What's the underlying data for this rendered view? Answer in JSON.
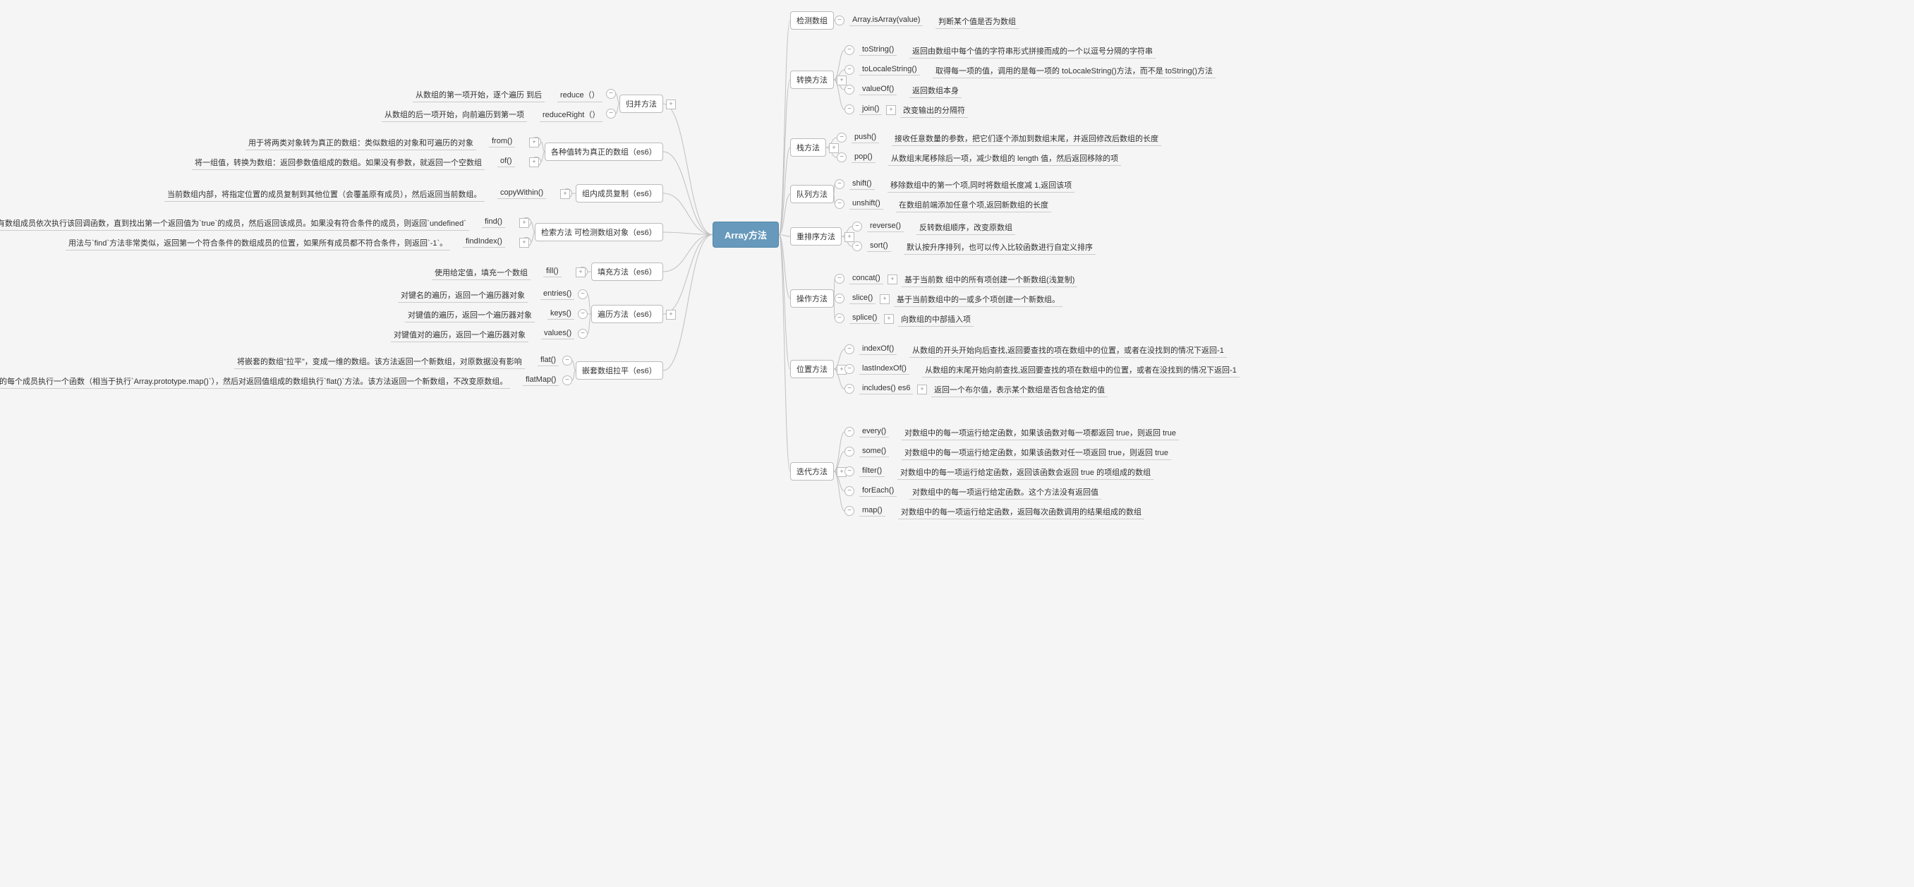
{
  "root": {
    "label": "Array方法"
  },
  "right": [
    {
      "label": "检测数组",
      "expand": false,
      "children": [
        {
          "label": "Array.isArray(value)",
          "note": "判断某个值是否为数组",
          "expand": false
        }
      ]
    },
    {
      "label": "转换方法",
      "expand": true,
      "children": [
        {
          "label": "toString()",
          "note": "返回由数组中每个值的字符串形式拼接而成的一个以逗号分隔的字符串",
          "expand": false
        },
        {
          "label": "toLocaleString()",
          "note": "取得每一项的值，调用的是每一项的 toLocaleString()方法，而不是 toString()方法",
          "expand": false
        },
        {
          "label": "valueOf()",
          "note": "返回数组本身",
          "expand": false
        },
        {
          "label": "join()",
          "note": "改变输出的分隔符",
          "expand": true
        }
      ]
    },
    {
      "label": "栈方法",
      "expand": true,
      "children": [
        {
          "label": "push()",
          "note": "接收任意数量的参数，把它们逐个添加到数组末尾，并返回修改后数组的长度",
          "expand": false
        },
        {
          "label": "pop()",
          "note": "从数组末尾移除后一项，减少数组的 length 值，然后返回移除的项",
          "expand": false
        }
      ]
    },
    {
      "label": "队列方法",
      "expand": false,
      "children": [
        {
          "label": "shift()",
          "note": "移除数组中的第一个项,同时将数组长度减 1,返回该项",
          "expand": false
        },
        {
          "label": "unshift()",
          "note": "在数组前端添加任意个项,返回新数组的长度",
          "expand": false
        }
      ]
    },
    {
      "label": "重排序方法",
      "expand": true,
      "children": [
        {
          "label": "reverse()",
          "note": "反转数组顺序，改变原数组",
          "expand": false
        },
        {
          "label": "sort()",
          "note": "默认按升序排列，也可以传入比较函数进行自定义排序",
          "expand": false
        }
      ]
    },
    {
      "label": "操作方法",
      "expand": false,
      "children": [
        {
          "label": "concat()",
          "note": "基于当前数 组中的所有项创建一个新数组(浅复制)",
          "expand": true
        },
        {
          "label": "slice()",
          "note": "基于当前数组中的一或多个项创建一个新数组。",
          "expand": true
        },
        {
          "label": "splice()",
          "note": "向数组的中部插入项",
          "expand": true
        }
      ]
    },
    {
      "label": "位置方法",
      "expand": true,
      "children": [
        {
          "label": "indexOf()",
          "note": "从数组的开头开始向后查找,返回要查找的项在数组中的位置，或者在没找到的情况下返回-1",
          "expand": false
        },
        {
          "label": "lastIndexOf()",
          "note": "从数组的末尾开始向前查找,返回要查找的项在数组中的位置，或者在没找到的情况下返回-1",
          "expand": false
        },
        {
          "label": "includes() es6",
          "note": "返回一个布尔值，表示某个数组是否包含给定的值",
          "expand": true
        }
      ]
    },
    {
      "label": "迭代方法",
      "expand": true,
      "children": [
        {
          "label": "every()",
          "note": "对数组中的每一项运行给定函数，如果该函数对每一项都返回 true，则返回 true",
          "expand": false
        },
        {
          "label": "some()",
          "note": "对数组中的每一项运行给定函数，如果该函数对任一项返回 true，则返回 true",
          "expand": false
        },
        {
          "label": "filter()",
          "note": "对数组中的每一项运行给定函数，返回该函数会返回 true 的项组成的数组",
          "expand": false
        },
        {
          "label": "forEach()",
          "note": "对数组中的每一项运行给定函数。这个方法没有返回值",
          "expand": false
        },
        {
          "label": "map()",
          "note": "对数组中的每一项运行给定函数，返回每次函数调用的结果组成的数组",
          "expand": false
        }
      ]
    }
  ],
  "left": [
    {
      "label": "归并方法",
      "expand": true,
      "children": [
        {
          "label": "reduce（）",
          "note": "从数组的第一项开始，逐个遍历 到后",
          "expand": false
        },
        {
          "label": "reduceRight（）",
          "note": "从数组的后一项开始，向前遍历到第一项",
          "expand": false
        }
      ]
    },
    {
      "label": "各种值转为真正的数组（es6）",
      "expand": false,
      "children": [
        {
          "label": "from()",
          "note": "用于将两类对象转为真正的数组：类似数组的对象和可遍历的对象",
          "expand": true
        },
        {
          "label": "of()",
          "note": "将一组值，转换为数组：返回参数值组成的数组。如果没有参数，就返回一个空数组",
          "expand": true
        }
      ]
    },
    {
      "label": "组内成员复制（es6）",
      "expand": false,
      "children": [
        {
          "label": "copyWithin()",
          "note": "当前数组内部，将指定位置的成员复制到其他位置（会覆盖原有成员），然后返回当前数组。",
          "expand": true
        }
      ]
    },
    {
      "label": "检索方法 可检测数组对象（es6）",
      "expand": false,
      "children": [
        {
          "label": "find()",
          "note": "用于找出第一个符合条件的数组成员。它的参数是一个回调函数，所有数组成员依次执行该回调函数，直到找出第一个返回值为`true`的成员，然后返回该成员。如果没有符合条件的成员，则返回`undefined`",
          "expand": true
        },
        {
          "label": "findIndex()",
          "note": "用法与`find`方法非常类似，返回第一个符合条件的数组成员的位置，如果所有成员都不符合条件，则返回`-1`。",
          "expand": true
        }
      ]
    },
    {
      "label": "填充方法（es6）",
      "expand": false,
      "children": [
        {
          "label": "fill()",
          "note": "使用给定值，填充一个数组",
          "expand": true
        }
      ]
    },
    {
      "label": "遍历方法（es6）",
      "expand": true,
      "children": [
        {
          "label": "entries()",
          "note": "对键名的遍历，返回一个遍历器对象",
          "expand": false
        },
        {
          "label": "keys()",
          "note": "对键值的遍历，返回一个遍历器对象",
          "expand": false
        },
        {
          "label": "values()",
          "note": "对键值对的遍历，返回一个遍历器对象",
          "expand": false
        }
      ]
    },
    {
      "label": "嵌套数组拉平（es6）",
      "expand": false,
      "children": [
        {
          "label": "flat()",
          "note": "将嵌套的数组\"拉平\"，变成一维的数组。该方法返回一个新数组，对原数据没有影响",
          "expand": false
        },
        {
          "label": "flatMap()",
          "note": "对原数组的每个成员执行一个函数（相当于执行`Array.prototype.map()`），然后对返回值组成的数组执行`flat()`方法。该方法返回一个新数组，不改变原数组。",
          "expand": false
        }
      ]
    }
  ]
}
